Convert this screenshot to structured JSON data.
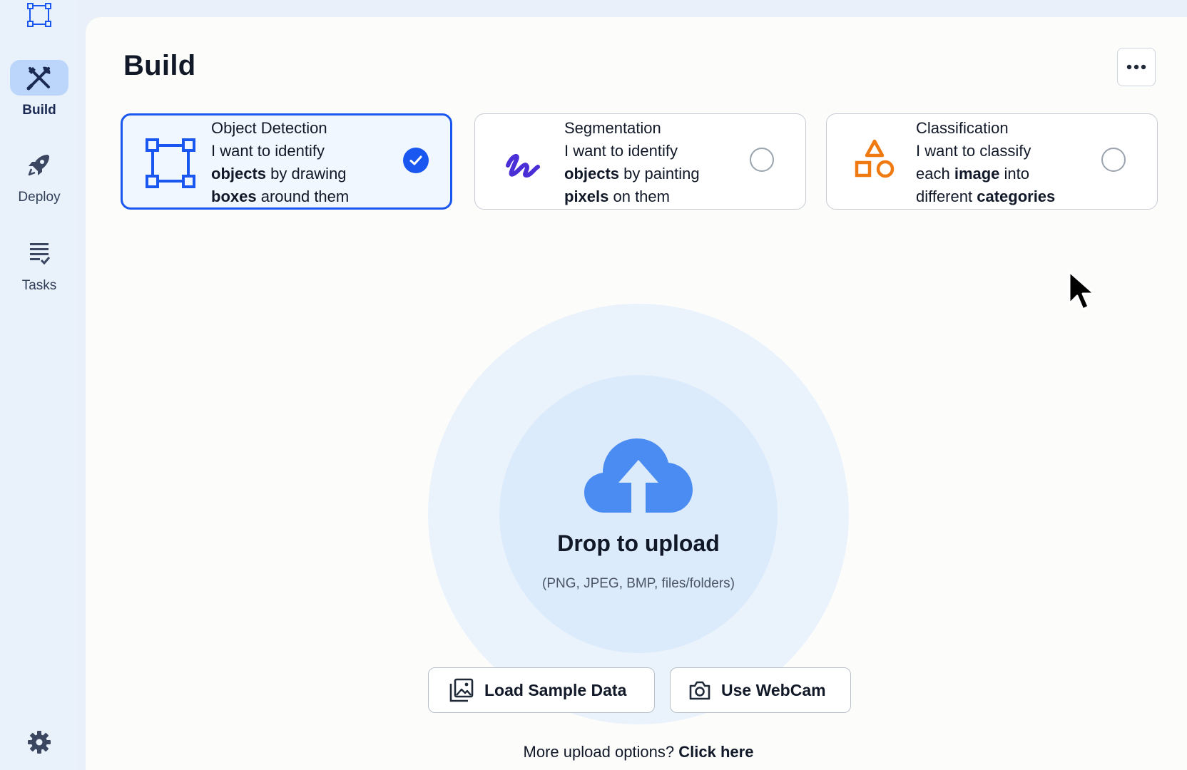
{
  "sidebar": {
    "logo_icon": "bounding-box-logo-icon",
    "items": [
      {
        "label": "Build",
        "icon": "tools-icon",
        "active": true
      },
      {
        "label": "Deploy",
        "icon": "rocket-icon",
        "active": false
      },
      {
        "label": "Tasks",
        "icon": "task-list-icon",
        "active": false
      }
    ],
    "settings_icon": "gear-icon"
  },
  "page": {
    "title": "Build",
    "more_icon": "ellipsis-icon"
  },
  "task_cards": [
    {
      "title": "Object Detection",
      "line1": "I want to identify",
      "line2_bold": "objects",
      "line2_rest": " by drawing",
      "line3_bold": "boxes",
      "line3_rest": " around them",
      "icon": "bounding-box-icon",
      "selected": true
    },
    {
      "title": "Segmentation",
      "line1": "I want to identify",
      "line2_bold": "objects",
      "line2_rest": " by painting",
      "line3_bold": "pixels",
      "line3_rest": " on them",
      "icon": "brush-stroke-icon",
      "selected": false
    },
    {
      "title": "Classification",
      "line1": "I want to classify",
      "line2_pre": "each ",
      "line2_bold": "image",
      "line2_rest": " into",
      "line3_pre": "different ",
      "line3_bold": "categories",
      "icon": "shapes-icon",
      "selected": false
    }
  ],
  "upload": {
    "icon": "cloud-upload-icon",
    "title": "Drop to upload",
    "subtitle": "(PNG, JPEG, BMP, files/folders)",
    "sample_button": "Load Sample Data",
    "sample_icon": "images-icon",
    "webcam_button": "Use WebCam",
    "webcam_icon": "camera-icon",
    "more_options_text": "More upload options?",
    "more_options_link": "Click here"
  },
  "colors": {
    "accent": "#1a56f0",
    "segmentation": "#4b2fd6",
    "classification": "#f07a12",
    "cloud": "#4a8cf2"
  }
}
